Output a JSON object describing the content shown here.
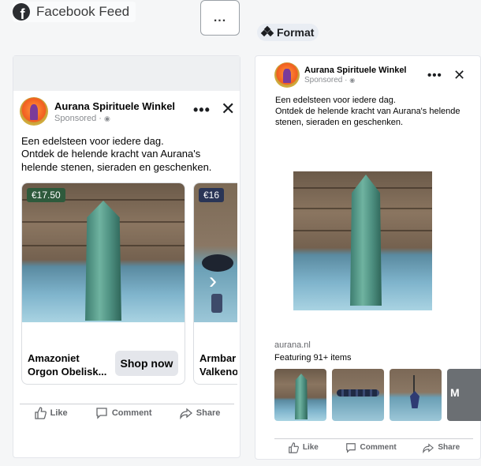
{
  "header": {
    "feed_title": "Facebook Feed",
    "more_label": "...",
    "format_label": "Format"
  },
  "ad": {
    "page_name": "Aurana Spirituele Winkel",
    "sponsored": "Sponsored · ",
    "body_line1": "Een edelsteen voor iedere dag.",
    "body_line2": "Ontdek de helende kracht van Aurana's helende stenen, sieraden en geschenken.",
    "domain": "aurana.nl",
    "featuring": "Featuring 91+ items"
  },
  "carousel": {
    "cards": [
      {
        "price": "€17.50",
        "title_line1": "Amazoniet",
        "title_line2": "Orgon Obelisk...",
        "cta": "Shop now"
      },
      {
        "price": "€16",
        "title_line1": "Armbar",
        "title_line2": "Valkeno"
      }
    ]
  },
  "thumb_partial_label": "M",
  "actions": {
    "like": "Like",
    "comment": "Comment",
    "share": "Share"
  },
  "colors": {
    "price_tag": "#2e5a3c",
    "action_gray": "#65676b"
  }
}
